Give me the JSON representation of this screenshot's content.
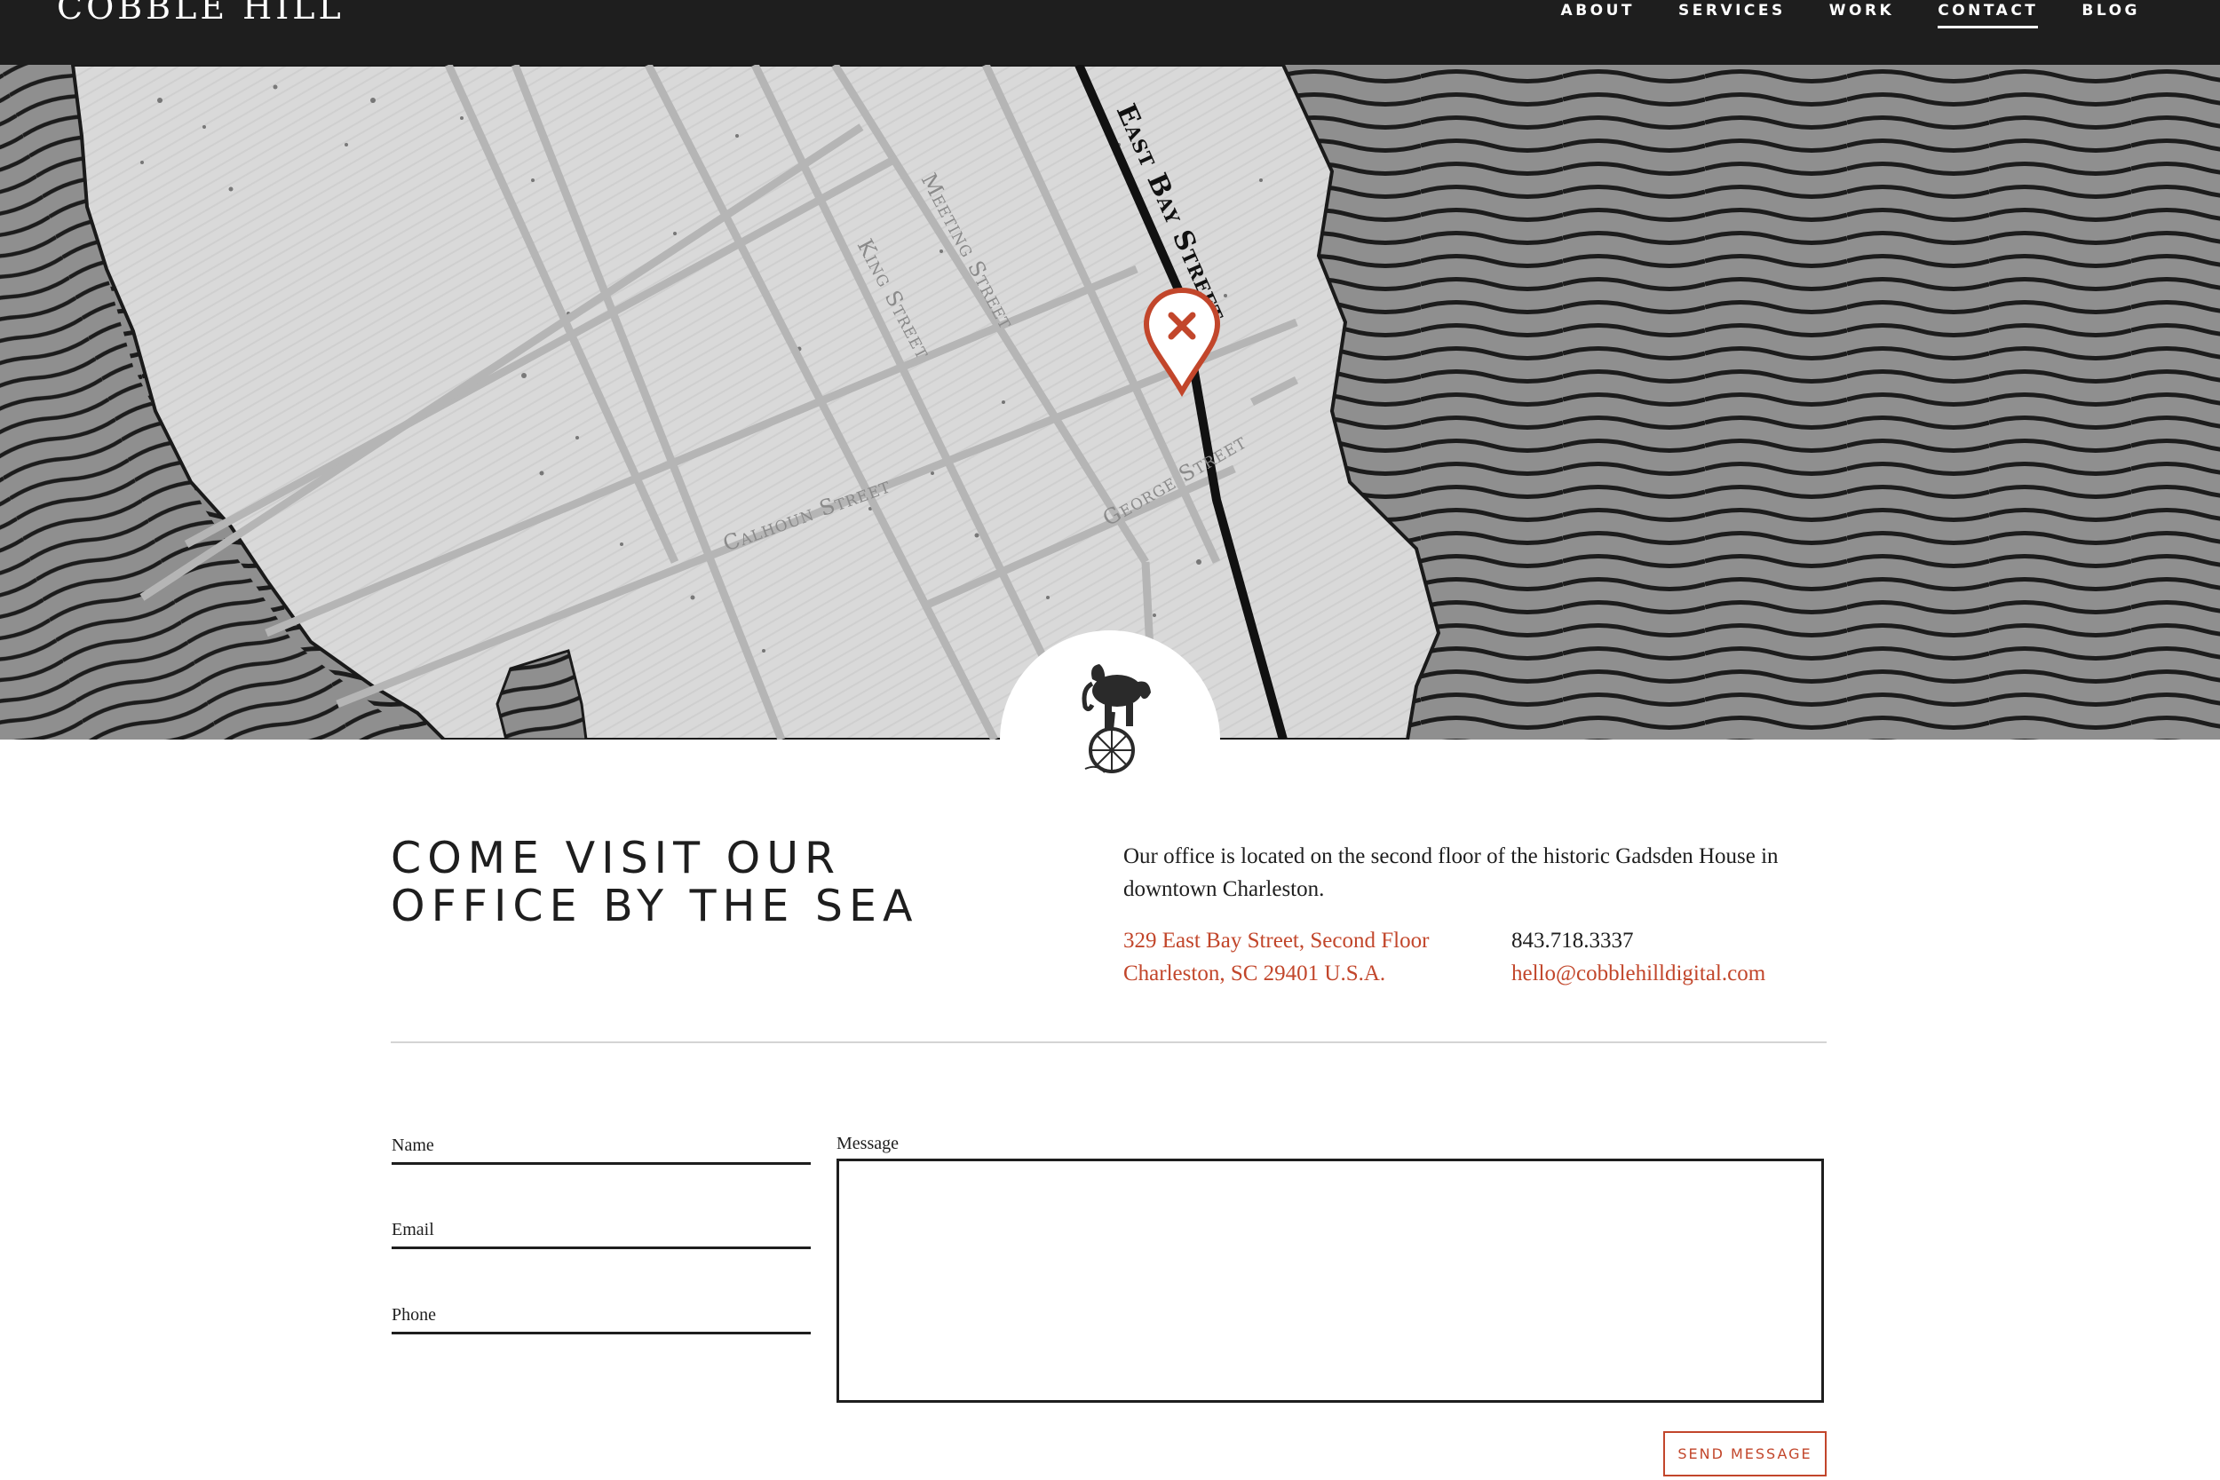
{
  "header": {
    "brand": "COBBLE HILL",
    "nav": [
      {
        "label": "ABOUT"
      },
      {
        "label": "SERVICES"
      },
      {
        "label": "WORK"
      },
      {
        "label": "CONTACT",
        "active": true
      },
      {
        "label": "BLOG"
      }
    ]
  },
  "map": {
    "streets": {
      "east_bay": "East Bay Street",
      "meeting": "Meeting Street",
      "king": "King Street",
      "calhoun": "Calhoun Street",
      "george": "George Street"
    },
    "marker_icon": "map-pin-x-icon",
    "badge_icon": "elephant-on-unicycle-icon"
  },
  "visit": {
    "title_line1": "COME VISIT OUR",
    "title_line2": "OFFICE BY THE SEA",
    "intro": "Our office is located on the second floor of the historic Gadsden House in downtown Charleston.",
    "address_line1": "329 East Bay Street, Second Floor",
    "address_line2": "Charleston, SC 29401 U.S.A.",
    "phone": "843.718.3337",
    "email": "hello@cobblehilldigital.com"
  },
  "form": {
    "name_label": "Name",
    "email_label": "Email",
    "phone_label": "Phone",
    "message_label": "Message",
    "send_label": "SEND MESSAGE"
  },
  "colors": {
    "accent": "#c2462b",
    "dark": "#1e1e1e",
    "water": "#8f8f8f",
    "land": "#d6d6d6"
  }
}
